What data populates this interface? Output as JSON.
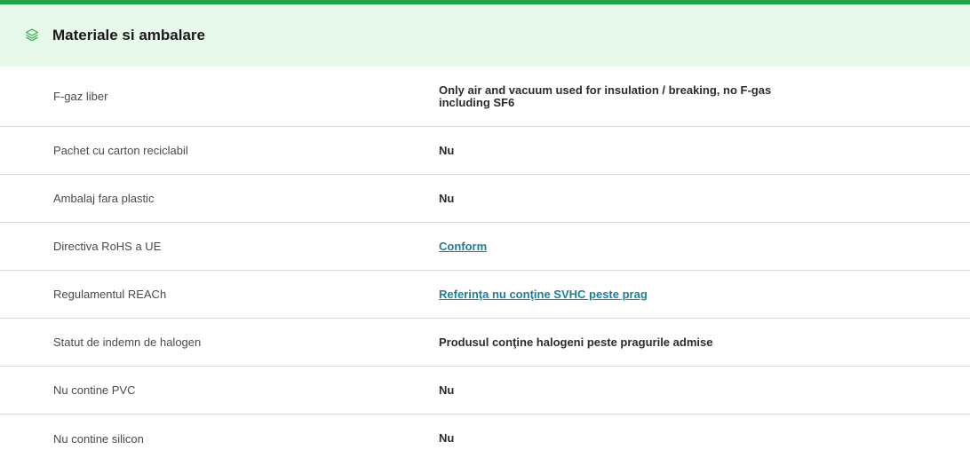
{
  "section": {
    "title": "Materiale si ambalare",
    "icon": "layers-icon",
    "accent_color": "#1fa34a",
    "header_bg": "#e8f9ec"
  },
  "rows": [
    {
      "label": "F-gaz liber",
      "value": "Only air and vacuum used for insulation / breaking, no F-gas including SF6",
      "link": false
    },
    {
      "label": "Pachet cu carton reciclabil",
      "value": "Nu",
      "link": false
    },
    {
      "label": "Ambalaj fara plastic",
      "value": "Nu",
      "link": false
    },
    {
      "label": "Directiva RoHS a UE",
      "value": "Conform",
      "link": true
    },
    {
      "label": "Regulamentul REACh",
      "value": "Referinţa nu conţine SVHC peste prag",
      "link": true
    },
    {
      "label": "Statut de indemn de halogen",
      "value": "Produsul conţine halogeni peste pragurile admise",
      "link": false
    },
    {
      "label": "Nu contine PVC",
      "value": "Nu",
      "link": false
    },
    {
      "label": "Nu contine silicon",
      "value": "Nu",
      "link": false
    }
  ]
}
